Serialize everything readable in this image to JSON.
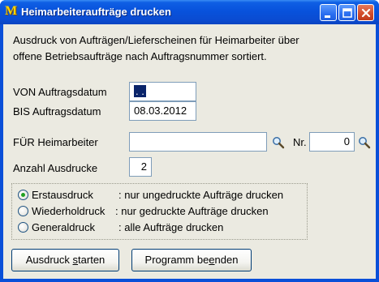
{
  "window": {
    "title": "Heimarbeiteraufträge drucken",
    "icon_letter": "M"
  },
  "description": {
    "line1": "Ausdruck von Aufträgen/Lieferscheinen für Heimarbeiter über",
    "line2": "offene Betriebsaufträge nach Auftragsnummer sortiert."
  },
  "form": {
    "von_label": "VON Auftragsdatum",
    "von_value": ". .",
    "bis_label": "BIS Auftragsdatum",
    "bis_value": "08.03.2012",
    "fuer_label": "FÜR Heimarbeiter",
    "fuer_value": "",
    "nr_label": "Nr.",
    "nr_value": "0",
    "anzahl_label": "Anzahl Ausdrucke",
    "anzahl_value": "2"
  },
  "options": [
    {
      "name": "Erstausdruck",
      "desc": ": nur ungedruckte Aufträge drucken",
      "selected": true
    },
    {
      "name": "Wiederholdruck",
      "desc": ": nur gedruckte Aufträge drucken",
      "selected": false
    },
    {
      "name": "Generaldruck",
      "desc": ": alle Aufträge drucken",
      "selected": false
    }
  ],
  "buttons": {
    "start_pre": "Ausdruck ",
    "start_ul": "s",
    "start_post": "tarten",
    "end_pre": "Programm be",
    "end_ul": "e",
    "end_post": "nden"
  },
  "colors": {
    "titlebar": "#0852dc",
    "dialog_bg": "#ebeae1",
    "selection": "#0a246a",
    "radio_dot": "#21a121"
  }
}
